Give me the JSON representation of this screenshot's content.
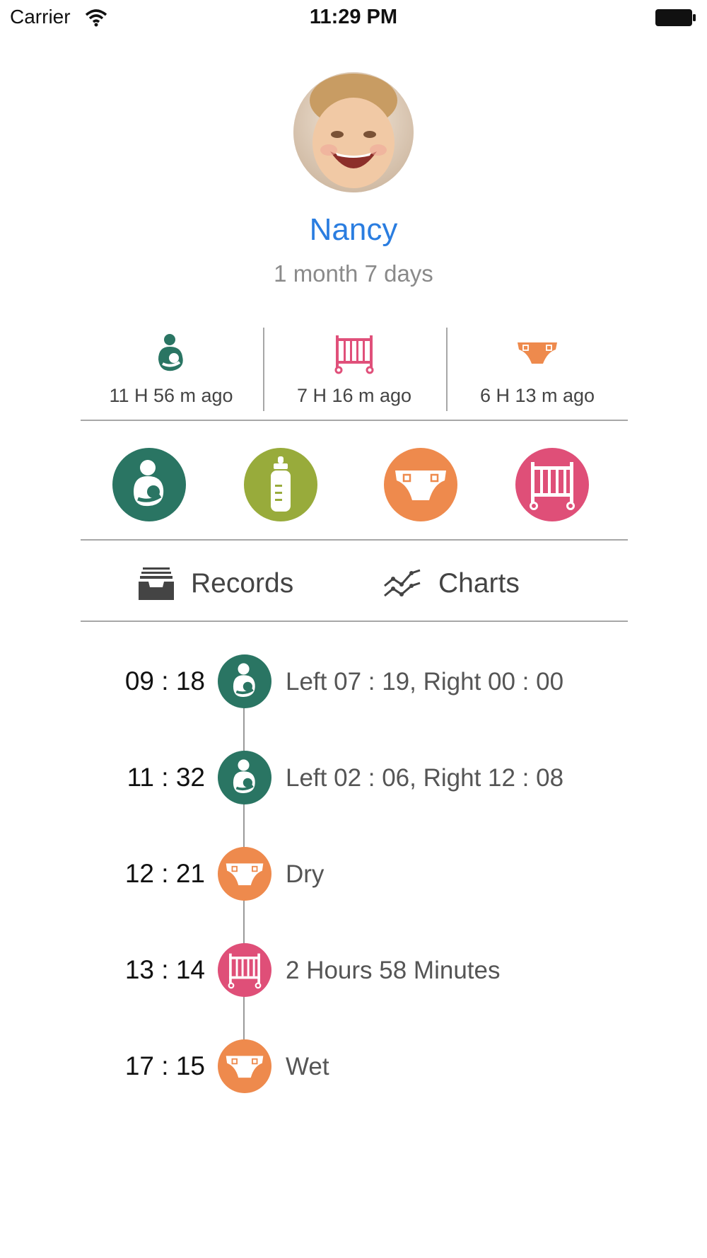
{
  "status_bar": {
    "carrier": "Carrier",
    "time": "11:29 PM"
  },
  "profile": {
    "name": "Nancy",
    "age": "1 month 7 days"
  },
  "last_events": [
    {
      "icon": "breastfeeding-icon",
      "text": "11 H 56 m ago",
      "color": "#2a7563"
    },
    {
      "icon": "crib-icon",
      "text": "7 H 16 m ago",
      "color": "#e0507a"
    },
    {
      "icon": "diaper-icon",
      "text": "6 H 13 m ago",
      "color": "#ee8a4d"
    }
  ],
  "actions": [
    {
      "icon": "breastfeeding-icon",
      "color": "#2a7563"
    },
    {
      "icon": "bottle-icon",
      "color": "#98ab3b"
    },
    {
      "icon": "diaper-icon",
      "color": "#ee8a4d"
    },
    {
      "icon": "crib-icon",
      "color": "#df4f78"
    }
  ],
  "tabs": {
    "records": "Records",
    "charts": "Charts"
  },
  "records": [
    {
      "time": "09 : 18",
      "type": "breastfeeding-icon",
      "desc": "Left 07 : 19, Right 00 : 00"
    },
    {
      "time": "11 : 32",
      "type": "breastfeeding-icon",
      "desc": "Left 02 : 06, Right 12 : 08"
    },
    {
      "time": "12 : 21",
      "type": "diaper-icon",
      "desc": "Dry"
    },
    {
      "time": "13 : 14",
      "type": "crib-icon",
      "desc": "2 Hours 58 Minutes"
    },
    {
      "time": "17 : 15",
      "type": "diaper-icon",
      "desc": "Wet"
    }
  ],
  "colors": {
    "green": "#2a7563",
    "olive": "#98ab3b",
    "orange": "#ee8a4d",
    "pink": "#df4f78",
    "name_blue": "#2a7de0"
  }
}
